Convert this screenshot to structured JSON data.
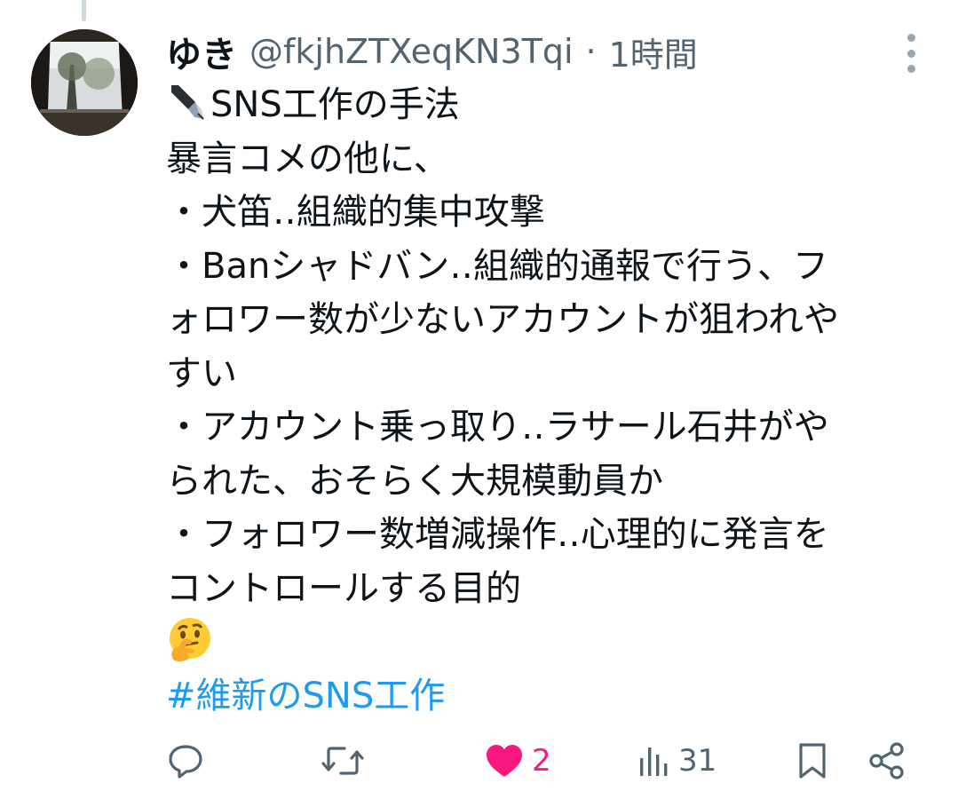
{
  "thread": {
    "has_parent": true
  },
  "author": {
    "display_name": "ゆき",
    "handle": "@fkjhZTXeqKN3Tqi",
    "separator": "·",
    "timestamp": "1時間"
  },
  "post": {
    "lines": [
      "SNS工作の手法",
      "暴言コメの他に、",
      "・犬笛‥組織的集中攻撃",
      "・Banシャドバン‥組織的通報で行う、フ",
      "ォロワー数が少ないアカウントが狙われや",
      "すい",
      "・アカウント乗っ取り‥ラサール石井がや",
      "られた、おそらく大規模動員か",
      "・フォロワー数増減操作‥心理的に発言を",
      "コントロールする目的"
    ],
    "leading_emoji": "pen-nib-icon",
    "trailing_emoji": "🤔",
    "hashtag": "#維新のSNS工作"
  },
  "actions": {
    "reply": {
      "icon": "reply-icon",
      "count": ""
    },
    "repost": {
      "icon": "repost-icon",
      "count": ""
    },
    "like": {
      "icon": "heart-filled-icon",
      "count": "2",
      "liked": true
    },
    "views": {
      "icon": "views-icon",
      "count": "31"
    },
    "bookmark": {
      "icon": "bookmark-icon"
    },
    "share": {
      "icon": "share-icon"
    }
  },
  "colors": {
    "text": "#0f1419",
    "secondary": "#536471",
    "link": "#1d9bf0",
    "like": "#f91880",
    "icon": "#536471"
  }
}
